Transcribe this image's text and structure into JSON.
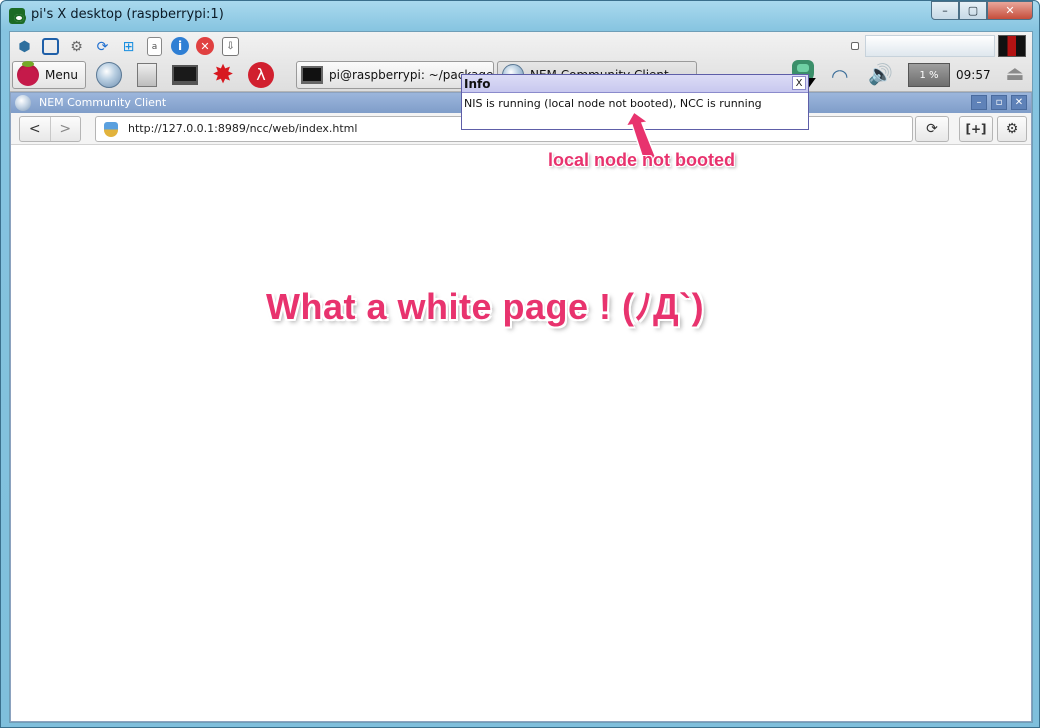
{
  "outer_window": {
    "title": "pi's X desktop (raspberrypi:1)",
    "minimize_glyph": "–",
    "maximize_glyph": "▢",
    "close_glyph": "✕"
  },
  "panel": {
    "quick_launch_icons": [
      "network-icon",
      "fullscreen-icon",
      "settings-gear-icon",
      "refresh-icon",
      "windows-icon",
      "document-icon",
      "info-icon",
      "close-red-icon",
      "transfer-icon"
    ],
    "menu_label": "Menu",
    "launchers": [
      "web-browser-icon",
      "file-manager-icon",
      "terminal-icon",
      "wolfram-icon",
      "mathematica-icon"
    ],
    "tasks": [
      {
        "label": "pi@raspberrypi: ~/package",
        "icon": "terminal-icon"
      },
      {
        "label": "NEM Community Client",
        "icon": "globe-icon"
      }
    ],
    "cpu_label": "1 %",
    "clock": "09:57"
  },
  "nem_window": {
    "title": "NEM Community Client",
    "url": "http://127.0.0.1:8989/ncc/web/index.html",
    "back_glyph": "<",
    "forward_glyph": ">",
    "reload_glyph": "⟳",
    "new_tab_glyph": "[+]",
    "settings_glyph": "⚙"
  },
  "info_popup": {
    "title": "Info",
    "close_label": "X",
    "message": "NIS is running (local node not booted), NCC is running"
  },
  "annotations": {
    "small": "local node not booted",
    "big": "What a white page ! (ﾉД`)"
  },
  "colors": {
    "annotation": "#e8336e",
    "nem_titlebar": "#8aa7d2",
    "popup_border": "#5e5ea8"
  }
}
